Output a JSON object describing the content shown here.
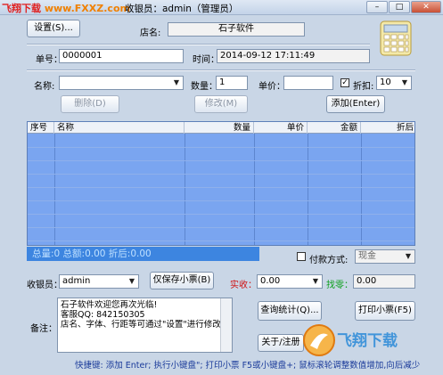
{
  "window": {
    "title": "收银员：admin（管理员）",
    "watermark_part1": "飞翔下载",
    "watermark_part2": " www.FXXZ.com",
    "min_label": "–",
    "max_label": "□",
    "close_label": "✕"
  },
  "header": {
    "settings_button": "设置(S)...",
    "store_label": "店名:",
    "store_name": "石子软件",
    "calculator_icon": "calculator-icon"
  },
  "order": {
    "number_label": "单号：",
    "number_value": "0000001",
    "time_label": "时间：",
    "time_value": "2014-09-12 17:11:49"
  },
  "entry": {
    "name_label": "名称:",
    "name_value": "",
    "qty_label": "数量：",
    "qty_value": "1",
    "price_label": "单价：",
    "price_value": "",
    "discount_checked": true,
    "discount_label": "折扣:",
    "discount_value": "10",
    "delete_button": "删除(D)",
    "edit_button": "修改(M)",
    "add_button": "添加(Enter)"
  },
  "table": {
    "columns": [
      "序号",
      "名称",
      "数量",
      "单价",
      "金额",
      "折后"
    ],
    "rows": []
  },
  "summary": {
    "text": "总量:0   总额:0.00   折后:0.00"
  },
  "payment": {
    "checked": false,
    "label": "付款方式:",
    "value": "现金"
  },
  "cashier": {
    "label": "收银员：",
    "value": "admin",
    "save_ticket_button": "仅保存小票(B)",
    "received_label": "实收：",
    "received_value": "0.00",
    "change_label": "找零：",
    "change_value": "0.00"
  },
  "notes": {
    "label": "备注：",
    "text": "石子软件欢迎您再次光临!\n客服QQ: 842150305\n店名、字体、行距等可通过\"设置\"进行修改"
  },
  "actions": {
    "stats_button": "查询统计(Q)...",
    "print_button": "打印小票(F5)",
    "about_button": "关于/注册"
  },
  "footer": {
    "shortcuts": "快捷键:  添加 Enter; 执行小键盘\"; 打印小票 F5或小键盘+; 鼠标滚轮调整数值增加,向后减少"
  },
  "colors": {
    "grid_bg": "#7aa5f0",
    "summary_bg": "#3d85e0",
    "window_bg": "#c9d6e6"
  }
}
